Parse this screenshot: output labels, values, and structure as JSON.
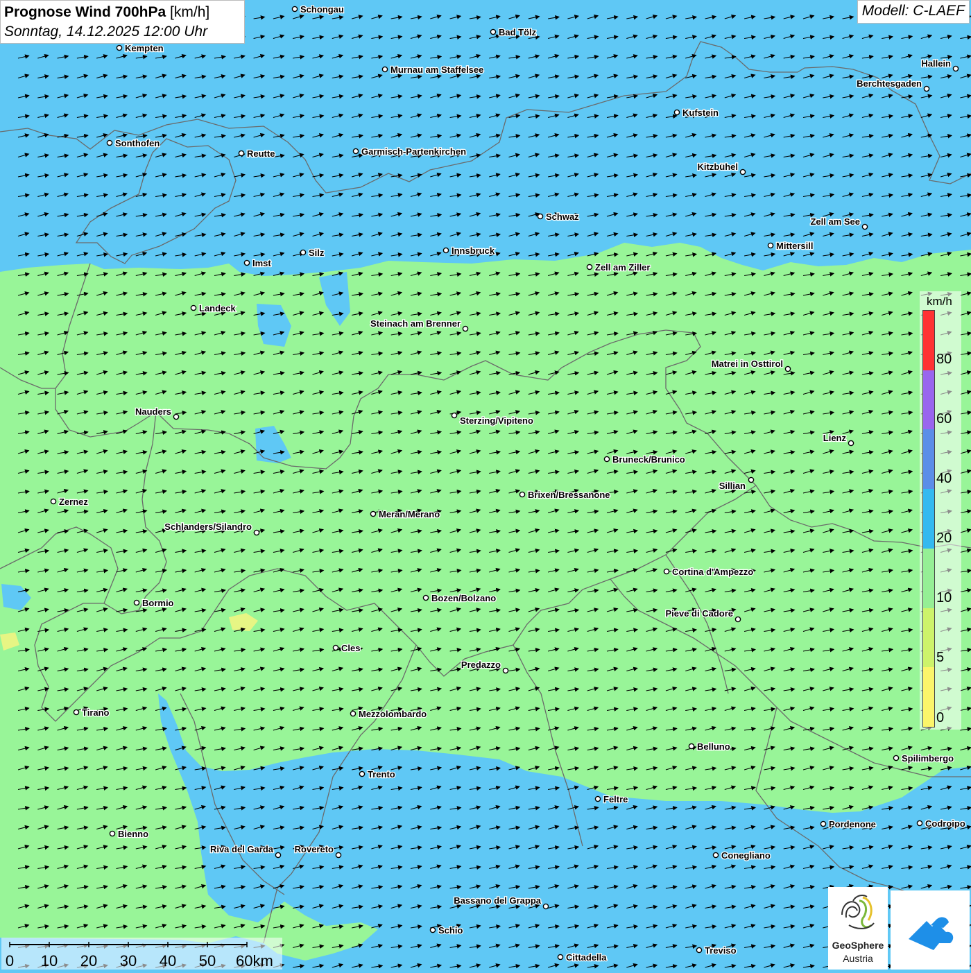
{
  "header": {
    "title_bold": "Prognose Wind 700hPa",
    "title_unit": "[km/h]",
    "datetime": "Sonntag, 14.12.2025 12:00 Uhr",
    "model": "Modell: C-LAEF"
  },
  "colors": {
    "wind_low_green": "#98f598",
    "wind_mid_blue": "#5fc8f5",
    "border_line": "#666666",
    "arrow": "#000000"
  },
  "legend": {
    "unit": "km/h",
    "labels": [
      "80",
      "60",
      "40",
      "20",
      "10",
      "5",
      "0"
    ],
    "bins": [
      {
        "color": "#ff3333"
      },
      {
        "color": "#9966ee"
      },
      {
        "color": "#5b8ee8"
      },
      {
        "color": "#34b9f0"
      },
      {
        "color": "#95ef95"
      },
      {
        "color": "#cdf36a"
      },
      {
        "color": "#fbf56a"
      }
    ]
  },
  "scalebar": {
    "labels": [
      "0",
      "10",
      "20",
      "30",
      "40",
      "50",
      "60km"
    ]
  },
  "logos": {
    "geosphere_line1": "GeoSphere",
    "geosphere_line2": "Austria"
  },
  "map": {
    "wind_direction": "from west-southwest",
    "places": [
      {
        "name": "Schongau"
      },
      {
        "name": "Bad Tölz"
      },
      {
        "name": "Kempten"
      },
      {
        "name": "Murnau am Staffelsee"
      },
      {
        "name": "Hallein"
      },
      {
        "name": "Berchtesgaden"
      },
      {
        "name": "Kufstein"
      },
      {
        "name": "Sonthofen"
      },
      {
        "name": "Reutte"
      },
      {
        "name": "Garmisch-Partenkirchen"
      },
      {
        "name": "Kitzbühel"
      },
      {
        "name": "Schwaz"
      },
      {
        "name": "Zell am See"
      },
      {
        "name": "Mittersill"
      },
      {
        "name": "Silz"
      },
      {
        "name": "Innsbruck"
      },
      {
        "name": "Imst"
      },
      {
        "name": "Zell am Ziller"
      },
      {
        "name": "Landeck"
      },
      {
        "name": "Steinach am Brenner"
      },
      {
        "name": "Matrei in Osttirol"
      },
      {
        "name": "Nauders"
      },
      {
        "name": "Sterzing/Vipiteno"
      },
      {
        "name": "Lienz"
      },
      {
        "name": "Bruneck/Brunico"
      },
      {
        "name": "Sillian"
      },
      {
        "name": "Brixen/Bressanone"
      },
      {
        "name": "Zernez"
      },
      {
        "name": "Meran/Merano"
      },
      {
        "name": "Schlanders/Silandro"
      },
      {
        "name": "Cortina d'Ampezzo"
      },
      {
        "name": "Bozen/Bolzano"
      },
      {
        "name": "Bormio"
      },
      {
        "name": "Pieve di Cadore"
      },
      {
        "name": "Cles"
      },
      {
        "name": "Predazzo"
      },
      {
        "name": "Tirano"
      },
      {
        "name": "Mezzolombardo"
      },
      {
        "name": "Belluno"
      },
      {
        "name": "Spilimbergo"
      },
      {
        "name": "Trento"
      },
      {
        "name": "Feltre"
      },
      {
        "name": "Pordenone"
      },
      {
        "name": "Codroipo"
      },
      {
        "name": "Bienno"
      },
      {
        "name": "Riva del Garda"
      },
      {
        "name": "Rovereto"
      },
      {
        "name": "Conegliano"
      },
      {
        "name": "Bassano del Grappa"
      },
      {
        "name": "Schio"
      },
      {
        "name": "Treviso"
      },
      {
        "name": "Cittadella"
      }
    ]
  }
}
